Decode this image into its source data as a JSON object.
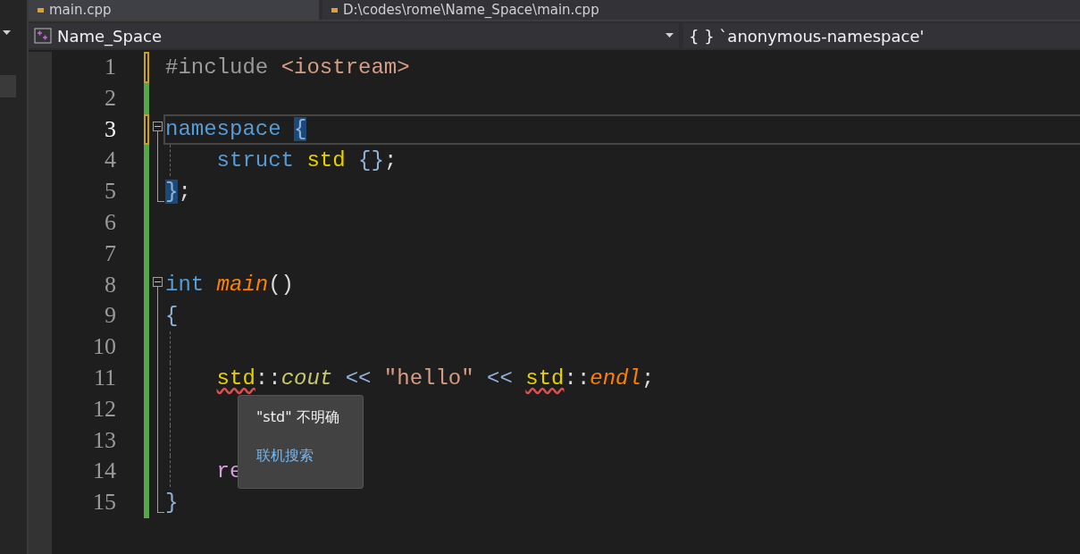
{
  "file_tabs": [
    {
      "label": "main.cpp",
      "selected": true
    },
    {
      "label": "D:\\codes\\rome\\Name_Space\\main.cpp",
      "selected": false
    }
  ],
  "nav_bar": {
    "project": "Name_Space",
    "scope": "{ } `anonymous-namespace'"
  },
  "editor": {
    "lines": [
      {
        "number": "1",
        "current": false,
        "modified": true,
        "guide": false,
        "tokens": [
          {
            "text": "#include ",
            "kind": "preproc"
          },
          {
            "text": "<iostream>",
            "kind": "string"
          }
        ]
      },
      {
        "number": "2",
        "current": false,
        "modified": false,
        "guide": false
      },
      {
        "number": "3",
        "current": true,
        "modified": true,
        "guide": false,
        "expanded": true,
        "tokens": [
          {
            "text": "namespace ",
            "kind": "keyword"
          },
          {
            "text": "{",
            "kind": "punct",
            "highlight": true
          }
        ]
      },
      {
        "number": "4",
        "current": false,
        "modified": false,
        "guide": true,
        "in_fold": true,
        "tokens": [
          {
            "text": "    struct ",
            "kind": "keyword"
          },
          {
            "text": "std",
            "kind": "type"
          },
          {
            "text": " {}",
            "kind": "punct"
          },
          {
            "text": ";",
            "kind": "plain"
          }
        ]
      },
      {
        "number": "5",
        "current": false,
        "modified": false,
        "guide": false,
        "fold_end": true,
        "tokens": [
          {
            "text": "}",
            "kind": "punct",
            "highlight": true
          },
          {
            "text": ";",
            "kind": "plain"
          }
        ]
      },
      {
        "number": "6",
        "current": false,
        "modified": false,
        "guide": false
      },
      {
        "number": "7",
        "current": false,
        "modified": false,
        "guide": false
      },
      {
        "number": "8",
        "current": false,
        "modified": false,
        "guide": false,
        "expanded": true,
        "tokens": [
          {
            "text": "int ",
            "kind": "keyword"
          },
          {
            "text": "main",
            "kind": "function"
          },
          {
            "text": "()",
            "kind": "plain"
          }
        ]
      },
      {
        "number": "9",
        "current": false,
        "modified": false,
        "guide": false,
        "in_fold": true,
        "tokens": [
          {
            "text": "{",
            "kind": "punct"
          }
        ]
      },
      {
        "number": "10",
        "current": false,
        "modified": false,
        "guide": true,
        "in_fold": true
      },
      {
        "number": "11",
        "current": false,
        "modified": false,
        "guide": true,
        "in_fold": true,
        "indented": true,
        "tokens": [
          {
            "text": "std",
            "kind": "type",
            "squiggle": true
          },
          {
            "text": "::",
            "kind": "plain"
          },
          {
            "text": "cout",
            "kind": "variable"
          },
          {
            "text": " << ",
            "kind": "punct"
          },
          {
            "text": "\"hello\"",
            "kind": "string"
          },
          {
            "text": " << ",
            "kind": "punct"
          },
          {
            "text": "std",
            "kind": "type",
            "squiggle": true
          },
          {
            "text": "::",
            "kind": "plain"
          },
          {
            "text": "endl",
            "kind": "function"
          },
          {
            "text": ";",
            "kind": "plain"
          }
        ]
      },
      {
        "number": "12",
        "current": false,
        "modified": false,
        "guide": true,
        "in_fold": true
      },
      {
        "number": "13",
        "current": false,
        "modified": false,
        "guide": true,
        "in_fold": true
      },
      {
        "number": "14",
        "current": false,
        "modified": false,
        "guide": true,
        "in_fold": true,
        "indented": true,
        "tokens": [
          {
            "text": "re",
            "kind": "control"
          }
        ]
      },
      {
        "number": "15",
        "current": false,
        "modified": false,
        "guide": false,
        "fold_end": true,
        "tokens": [
          {
            "text": "}",
            "kind": "punct"
          }
        ]
      }
    ]
  },
  "tooltip": {
    "message": "\"std\" 不明确",
    "link": "联机搜索"
  }
}
